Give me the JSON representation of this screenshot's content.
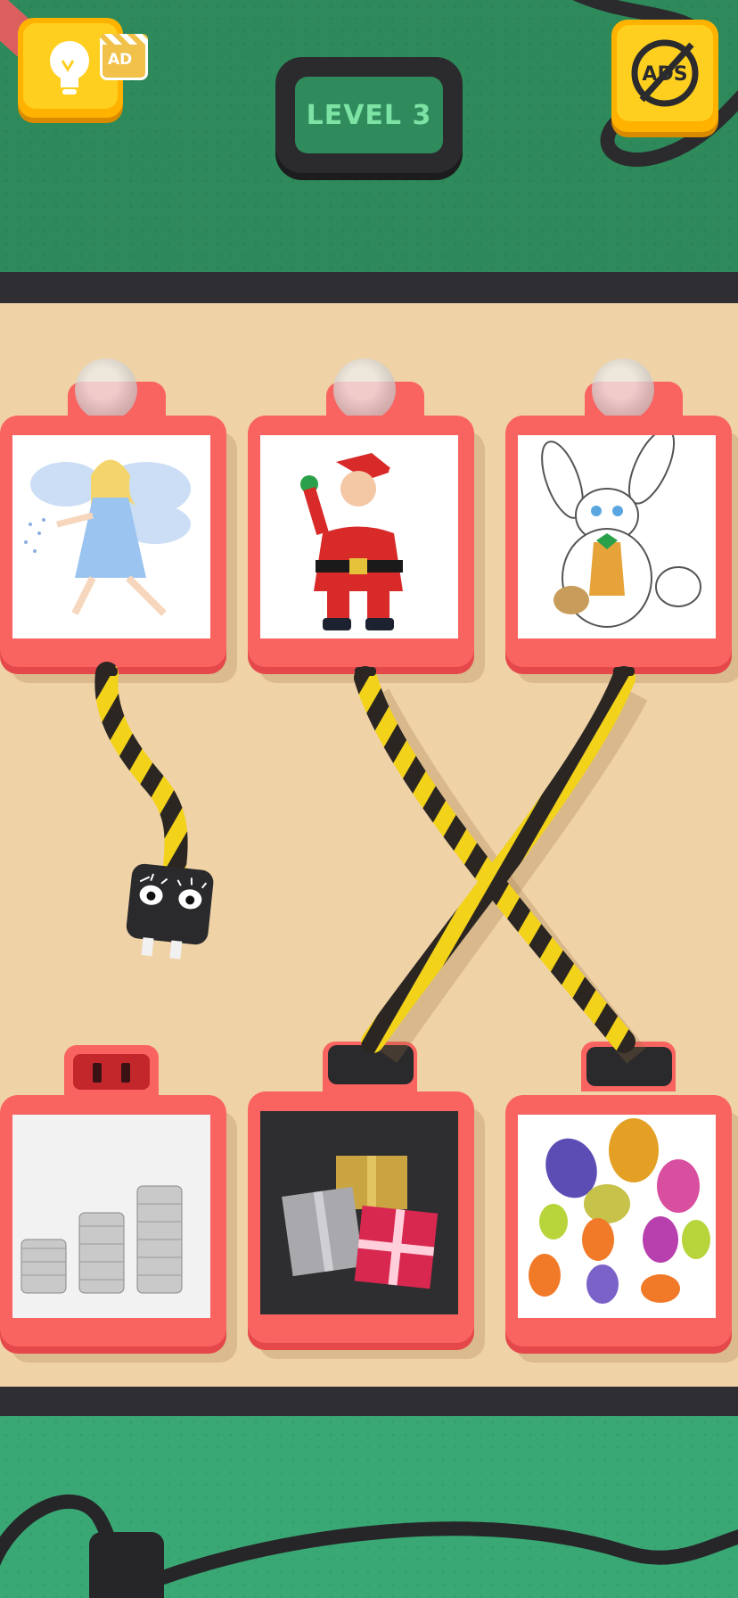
{
  "level": {
    "label": "LEVEL 3"
  },
  "buttons": {
    "hint_badge": "AD",
    "no_ads": "ADS"
  },
  "cards_top": [
    {
      "name": "fairy",
      "subject": "fairy"
    },
    {
      "name": "santa",
      "subject": "santa-claus"
    },
    {
      "name": "bunny",
      "subject": "easter-bunny"
    }
  ],
  "cards_bottom": [
    {
      "name": "coins",
      "subject": "coins"
    },
    {
      "name": "gifts",
      "subject": "gift-boxes"
    },
    {
      "name": "eggs",
      "subject": "easter-eggs"
    }
  ],
  "colors": {
    "board": "#efd2a6",
    "card": "#f96360",
    "wire_yellow": "#f3d21a",
    "wire_black": "#2b2622",
    "top_bg": "#2e8a5a",
    "bottom_bg": "#3aa874"
  }
}
